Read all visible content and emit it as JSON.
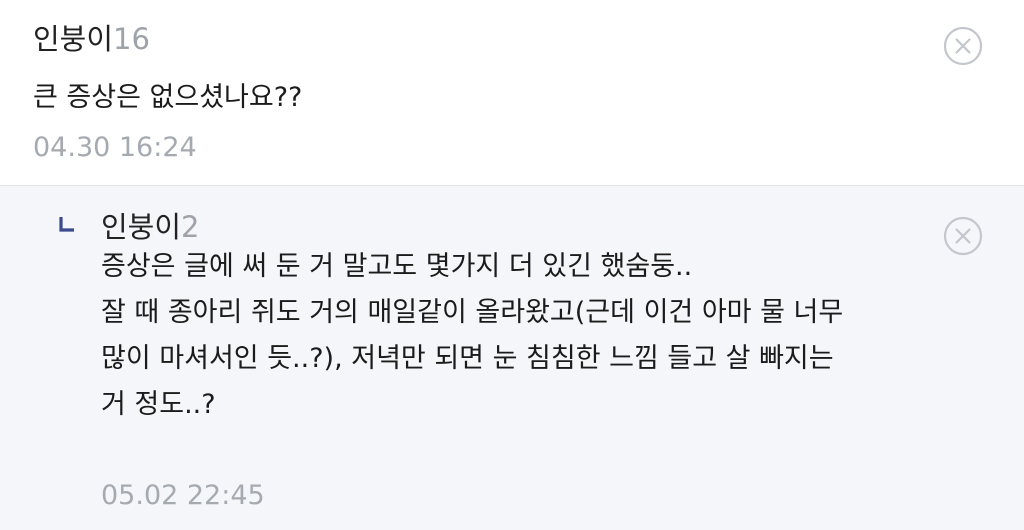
{
  "comment": {
    "author": "인붕이",
    "author_suffix": "16",
    "text": "큰 증상은 없으셨나요??",
    "timestamp": "04.30 16:24"
  },
  "reply": {
    "author": "인붕이",
    "author_suffix": "2",
    "lines": [
      "증상은 글에 써 둔 거 말고도 몇가지 더 있긴 했숨둥..",
      "잘 때 종아리 쥐도 거의 매일같이 올라왔고(근데 이건 아마 물 너무",
      "많이 마셔서인 듯..?), 저녁만 되면 눈 침침한 느낌 들고 살 빠지는",
      "거 정도..?"
    ],
    "timestamp": "05.02 22:45"
  },
  "icons": {
    "close": "close-circle-icon",
    "reply_marker": "reply-corner-icon"
  },
  "colors": {
    "reply_background": "#f5f6f9",
    "timestamp": "#a5aab1",
    "reply_marker": "#3a4a8c"
  }
}
